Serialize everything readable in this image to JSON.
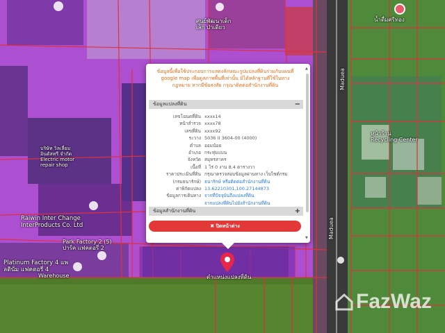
{
  "map": {
    "road_label_top": "Maduea",
    "road_label_bottom": "Maduea",
    "place_labels": {
      "top_center": "ศูนย์พัฒนาเด็ก\nเล็ก ป่าเดียว",
      "top_right": "น้ำดื่มศรีทอง",
      "right_mid": "หน้าร้าน\nRecycling Center",
      "left_mid": "บริษัท วิลเลี่ยม\nอินดัสทรี จำกัด\nElectric motor\nrepair shop",
      "left_company": "Raiwin Inter Change\nInterProducts Co. Ltd",
      "left_park": "Park Factory 2 (5)\nปาร์ค แฟคตอรี่ 2",
      "left_platinum": "Platinum Factory 4 แพ\nลตินั่ม แฟคตอรี่ 4",
      "left_warehouse": "Warehouse",
      "pin_label": "ตำแหน่งแปลงที่ดิน"
    },
    "watermark": "FazWaz",
    "colors": {
      "parcel_fill": "#b040d0",
      "parcel_line": "#e03040",
      "pin": "#e6264b"
    }
  },
  "popup": {
    "notice": "ข้อมูลนี้เพื่อใช้ประกอบการแสดงลักษณะรูปแปลงที่ดินร่วมกับแผนที่ google map เพื่อดูสภาพพื้นที่เท่านั้น มิได้หลักฐานที่ใช้ในทางกฎหมาย หากมีข้อสงสัย กรุณาติดต่อสำนักงานที่ดิน",
    "section1_title": "ข้อมูลแปลงที่ดิน",
    "section1_toggle": "−",
    "rows": [
      {
        "k": "เลขโฉนดที่ดิน",
        "v": "xxxx14"
      },
      {
        "k": "หน้าสำรวจ",
        "v": "xxxx78"
      },
      {
        "k": "เลขที่ดิน",
        "v": "xxxx92"
      },
      {
        "k": "ระวาง",
        "v": "5036 II 3604-00 (4000)"
      },
      {
        "k": "ตำบล",
        "v": "ออมน้อย"
      },
      {
        "k": "อำเภอ",
        "v": "กระทุ่มแบน"
      },
      {
        "k": "จังหวัด",
        "v": "สมุทรสาคร"
      },
      {
        "k": "เนื้อที่",
        "v": "1 ไร่ 0 งาน 8.4 ตารางวา"
      },
      {
        "k": "ราคาประเมินที่ดิน",
        "v": "กรุณาตรวจสอบข้อมูลผ่านทาง เว็บไซต์กรม"
      },
      {
        "k": "(กรมธนารักษ์)",
        "v": "ธนารักษ์ หรือติดต่อสำนักงานที่ดิน"
      },
      {
        "k": "ค่าพิกัดแปลง",
        "v": "13.62210301,100.27144873"
      },
      {
        "k": "ข้อมูลการเดินทาง",
        "v": "จากที่ปัจจุบันถึงแปลงที่ดิน"
      },
      {
        "k": "",
        "v": "จากแปลงที่ดินไปยังสำนักงานที่ดิน"
      }
    ],
    "section2_title": "ข้อมูลสำนักงานที่ดิน",
    "section2_toggle": "+",
    "close_label": "✖ ปิดหน้าต่าง"
  }
}
